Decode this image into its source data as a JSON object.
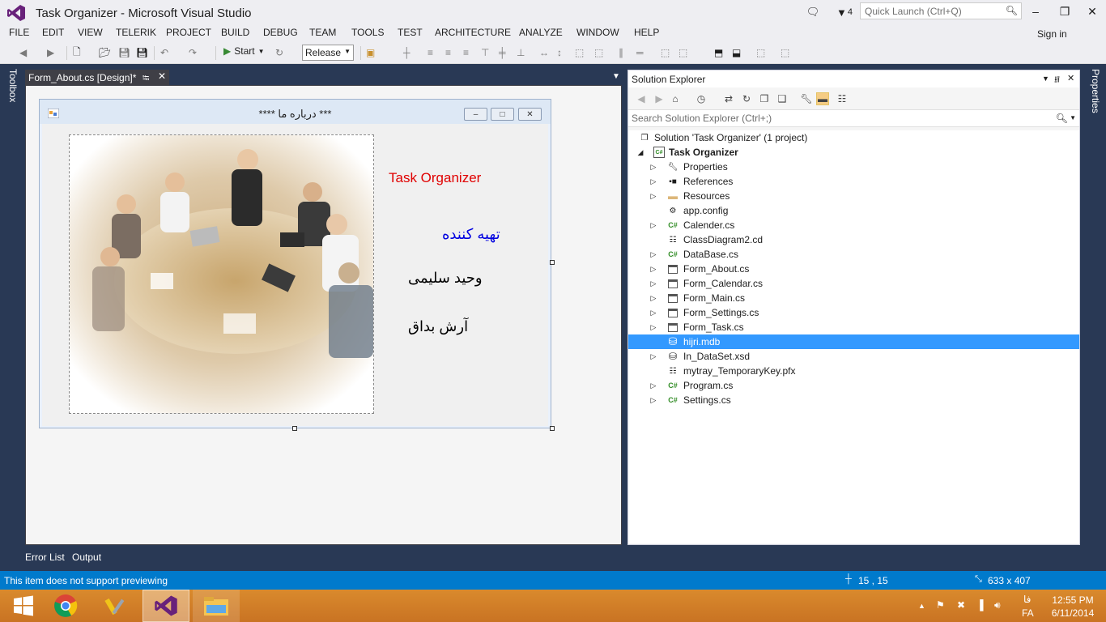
{
  "window": {
    "title": "Task Organizer - Microsoft Visual Studio",
    "notification_count": "4",
    "quick_launch_placeholder": "Quick Launch (Ctrl+Q)",
    "sign_in": "Sign in"
  },
  "menu": [
    "FILE",
    "EDIT",
    "VIEW",
    "TELERIK",
    "PROJECT",
    "BUILD",
    "DEBUG",
    "TEAM",
    "TOOLS",
    "TEST",
    "ARCHITECTURE",
    "ANALYZE",
    "WINDOW",
    "HELP"
  ],
  "toolbar": {
    "start_label": "Start",
    "configuration": "Release"
  },
  "side_tabs": {
    "left": "Toolbox",
    "right": "Properties"
  },
  "document": {
    "tab_title": "Form_About.cs [Design]*"
  },
  "form": {
    "title": "****  درباره  ما  ***",
    "app_label": "Task Organizer",
    "prepared_by": "تهیه کننده",
    "author1": "وحید سلیمی",
    "author2": "آرش بداق"
  },
  "solution_explorer": {
    "title": "Solution Explorer",
    "search_placeholder": "Search Solution Explorer (Ctrl+;)",
    "items": [
      {
        "label": "Solution 'Task Organizer' (1 project)",
        "icon": "solution-icon",
        "expander": ""
      },
      {
        "label": "Task Organizer",
        "icon": "csharp-project-icon",
        "expander": "expanded"
      },
      {
        "label": "Properties",
        "icon": "wrench-icon",
        "expander": "collapsed"
      },
      {
        "label": "References",
        "icon": "references-icon",
        "expander": "collapsed"
      },
      {
        "label": "Resources",
        "icon": "folder-icon",
        "expander": "collapsed"
      },
      {
        "label": "app.config",
        "icon": "config-icon",
        "expander": ""
      },
      {
        "label": "Calender.cs",
        "icon": "csharp-file-icon",
        "expander": "collapsed"
      },
      {
        "label": "ClassDiagram2.cd",
        "icon": "class-diagram-icon",
        "expander": ""
      },
      {
        "label": "DataBase.cs",
        "icon": "csharp-file-icon",
        "expander": "collapsed"
      },
      {
        "label": "Form_About.cs",
        "icon": "form-icon",
        "expander": "collapsed"
      },
      {
        "label": "Form_Calendar.cs",
        "icon": "form-icon",
        "expander": "collapsed"
      },
      {
        "label": "Form_Main.cs",
        "icon": "form-icon",
        "expander": "collapsed"
      },
      {
        "label": "Form_Settings.cs",
        "icon": "form-icon",
        "expander": "collapsed"
      },
      {
        "label": "Form_Task.cs",
        "icon": "form-icon",
        "expander": "collapsed"
      },
      {
        "label": "hijri.mdb",
        "icon": "database-icon",
        "expander": "",
        "selected": true
      },
      {
        "label": "In_DataSet.xsd",
        "icon": "dataset-icon",
        "expander": "collapsed"
      },
      {
        "label": "mytray_TemporaryKey.pfx",
        "icon": "certificate-icon",
        "expander": ""
      },
      {
        "label": "Program.cs",
        "icon": "csharp-file-icon",
        "expander": "collapsed"
      },
      {
        "label": "Settings.cs",
        "icon": "csharp-file-icon",
        "expander": "collapsed"
      }
    ]
  },
  "bottom_tabs": [
    "Error List",
    "Output"
  ],
  "status": {
    "message": "This item does not support previewing",
    "position": "15 , 15",
    "size": "633 x 407"
  },
  "taskbar": {
    "language_top": "فا",
    "language": "FA",
    "time": "12:55 PM",
    "date": "6/11/2014"
  },
  "colors": {
    "accent": "#007acc",
    "selection": "#3399ff",
    "app_label": "#e00000",
    "prepared_by": "#0000e0"
  }
}
